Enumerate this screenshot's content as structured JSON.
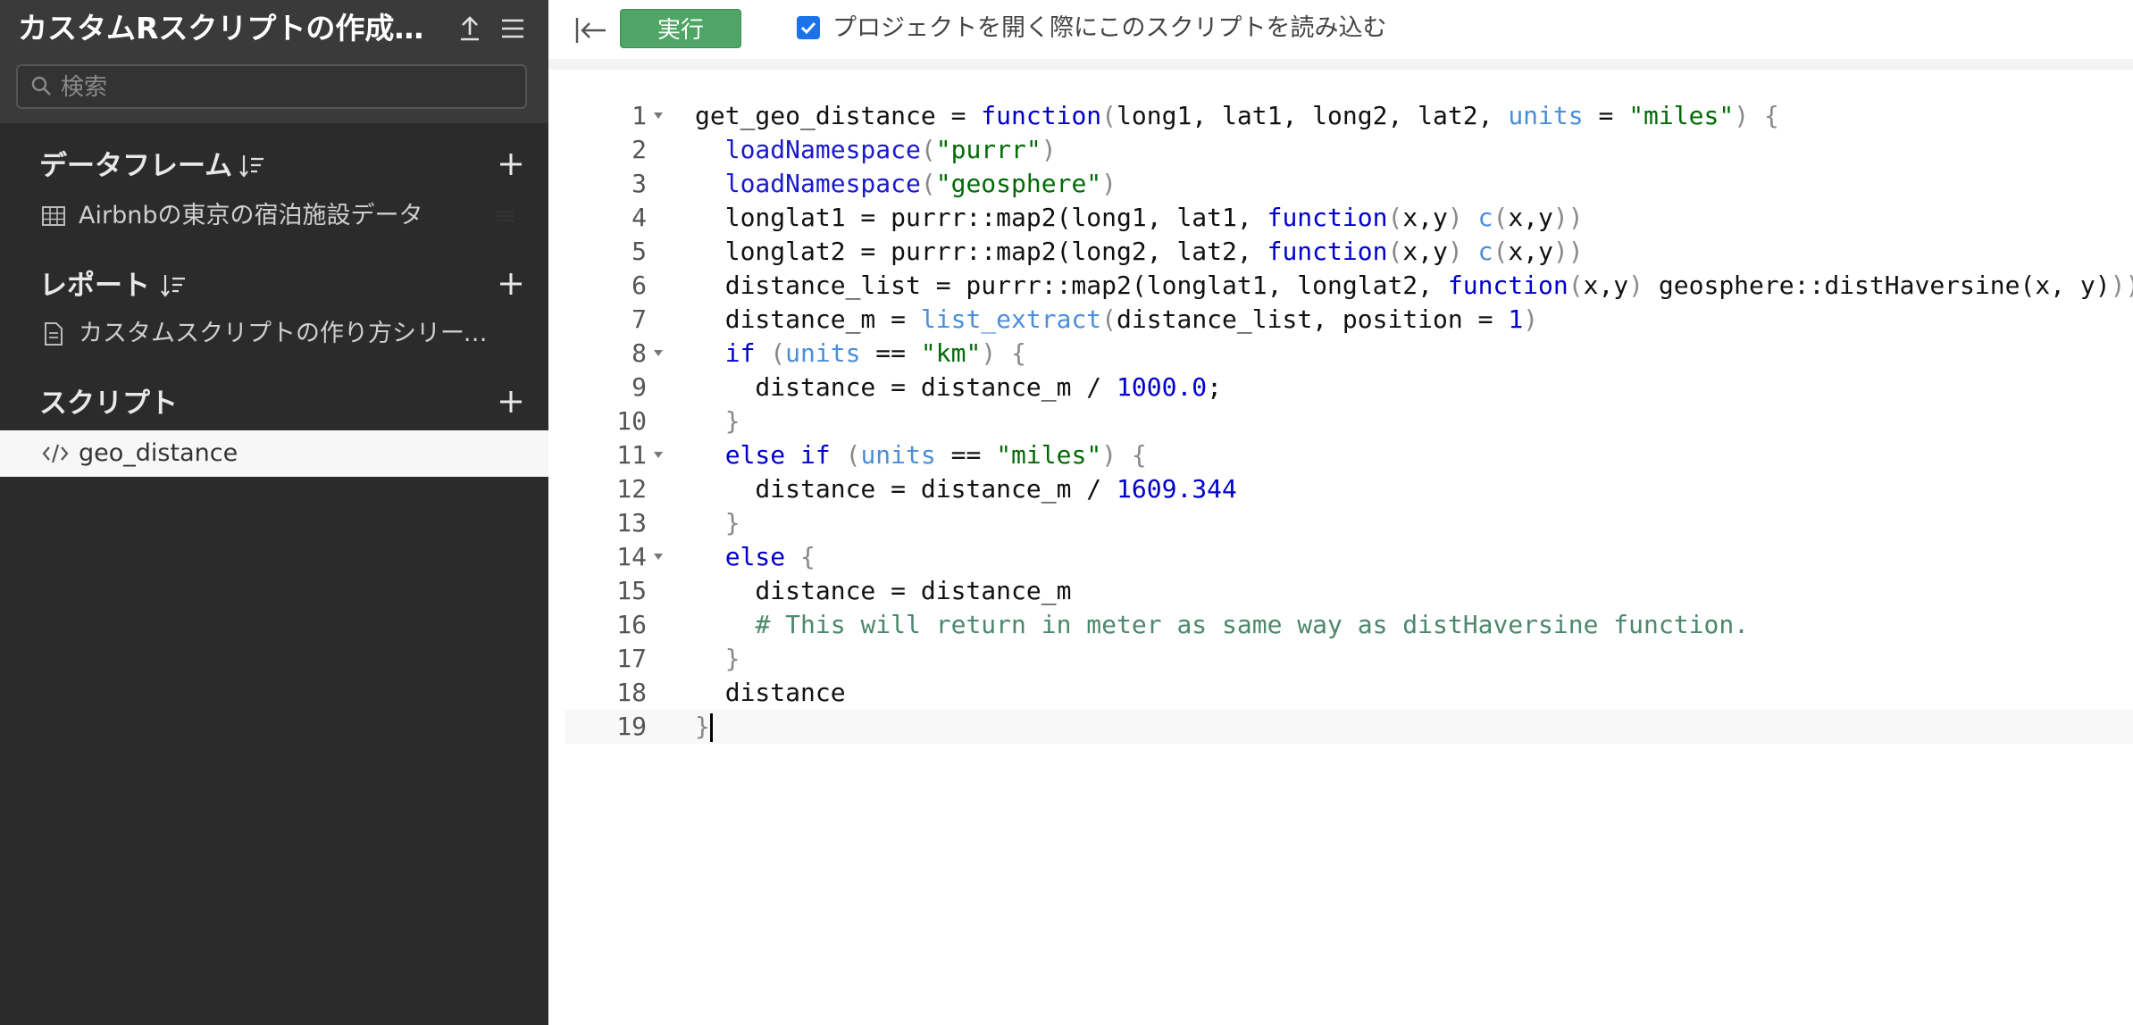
{
  "sidebar": {
    "project_title": "カスタムRスクリプトの作成シ...",
    "search_placeholder": "検索",
    "sections": {
      "dataframes": {
        "title": "データフレーム",
        "items": [
          {
            "label": "Airbnbの東京の宿泊施設データ"
          }
        ]
      },
      "reports": {
        "title": "レポート",
        "items": [
          {
            "label": "カスタムスクリプトの作り方シリーズ: ..."
          }
        ]
      },
      "scripts": {
        "title": "スクリプト",
        "items": [
          {
            "label": "geo_distance"
          }
        ]
      }
    },
    "icons": {
      "upload": "upload-icon",
      "menu": "hamburger-menu-icon",
      "search": "search-icon",
      "sort": "sort-icon",
      "add": "plus-icon",
      "table": "table-icon",
      "document": "document-icon",
      "code": "code-icon"
    }
  },
  "toolbar": {
    "run_label": "実行",
    "load_on_open_label": "プロジェクトを開く際にこのスクリプトを読み込む",
    "load_on_open_checked": true
  },
  "colors": {
    "sidebar_bg": "#2b2b2b",
    "sidebar_header_bg": "#3a3a3a",
    "run_button": "#4ea565",
    "checkbox": "#1a73e8"
  },
  "editor": {
    "current_line": 19,
    "lines": [
      {
        "n": "1",
        "fold": true,
        "tokens": [
          [
            "plain",
            "get_geo_distance = "
          ],
          [
            "kw",
            "function"
          ],
          [
            "paren",
            "("
          ],
          [
            "plain",
            "long1, lat1, long2, lat2, "
          ],
          [
            "param",
            "units"
          ],
          [
            "plain",
            " = "
          ],
          [
            "str",
            "\"miles\""
          ],
          [
            "paren",
            ")"
          ],
          [
            "plain",
            " "
          ],
          [
            "paren",
            "{"
          ]
        ]
      },
      {
        "n": "2",
        "fold": false,
        "tokens": [
          [
            "plain",
            "  "
          ],
          [
            "fn",
            "loadNamespace"
          ],
          [
            "paren",
            "("
          ],
          [
            "str",
            "\"purrr\""
          ],
          [
            "paren",
            ")"
          ]
        ]
      },
      {
        "n": "3",
        "fold": false,
        "tokens": [
          [
            "plain",
            "  "
          ],
          [
            "fn",
            "loadNamespace"
          ],
          [
            "paren",
            "("
          ],
          [
            "str",
            "\"geosphere\""
          ],
          [
            "paren",
            ")"
          ]
        ]
      },
      {
        "n": "4",
        "fold": false,
        "tokens": [
          [
            "plain",
            "  longlat1 = purrr::map2(long1, lat1, "
          ],
          [
            "kw",
            "function"
          ],
          [
            "paren",
            "("
          ],
          [
            "plain",
            "x,y"
          ],
          [
            "paren",
            ")"
          ],
          [
            "plain",
            " "
          ],
          [
            "call",
            "c"
          ],
          [
            "paren",
            "("
          ],
          [
            "plain",
            "x,y"
          ],
          [
            "paren",
            "))"
          ]
        ]
      },
      {
        "n": "5",
        "fold": false,
        "tokens": [
          [
            "plain",
            "  longlat2 = purrr::map2(long2, lat2, "
          ],
          [
            "kw",
            "function"
          ],
          [
            "paren",
            "("
          ],
          [
            "plain",
            "x,y"
          ],
          [
            "paren",
            ")"
          ],
          [
            "plain",
            " "
          ],
          [
            "call",
            "c"
          ],
          [
            "paren",
            "("
          ],
          [
            "plain",
            "x,y"
          ],
          [
            "paren",
            "))"
          ]
        ]
      },
      {
        "n": "6",
        "fold": false,
        "tokens": [
          [
            "plain",
            "  distance_list = purrr::map2(longlat1, longlat2, "
          ],
          [
            "kw",
            "function"
          ],
          [
            "paren",
            "("
          ],
          [
            "plain",
            "x,y"
          ],
          [
            "paren",
            ")"
          ],
          [
            "plain",
            " geosphere::distHaversine(x, y)"
          ],
          [
            "paren",
            "))"
          ]
        ]
      },
      {
        "n": "7",
        "fold": false,
        "tokens": [
          [
            "plain",
            "  distance_m = "
          ],
          [
            "call",
            "list_extract"
          ],
          [
            "paren",
            "("
          ],
          [
            "plain",
            "distance_list, position = "
          ],
          [
            "num",
            "1"
          ],
          [
            "paren",
            ")"
          ]
        ]
      },
      {
        "n": "8",
        "fold": true,
        "tokens": [
          [
            "plain",
            "  "
          ],
          [
            "kw",
            "if"
          ],
          [
            "plain",
            " "
          ],
          [
            "paren",
            "("
          ],
          [
            "param",
            "units"
          ],
          [
            "plain",
            " == "
          ],
          [
            "str",
            "\"km\""
          ],
          [
            "paren",
            ")"
          ],
          [
            "plain",
            " "
          ],
          [
            "paren",
            "{"
          ]
        ]
      },
      {
        "n": "9",
        "fold": false,
        "tokens": [
          [
            "plain",
            "    distance = distance_m / "
          ],
          [
            "num",
            "1000.0"
          ],
          [
            "plain",
            ";"
          ]
        ]
      },
      {
        "n": "10",
        "fold": false,
        "tokens": [
          [
            "plain",
            "  "
          ],
          [
            "paren",
            "}"
          ]
        ]
      },
      {
        "n": "11",
        "fold": true,
        "tokens": [
          [
            "plain",
            "  "
          ],
          [
            "kw",
            "else if"
          ],
          [
            "plain",
            " "
          ],
          [
            "paren",
            "("
          ],
          [
            "param",
            "units"
          ],
          [
            "plain",
            " == "
          ],
          [
            "str",
            "\"miles\""
          ],
          [
            "paren",
            ")"
          ],
          [
            "plain",
            " "
          ],
          [
            "paren",
            "{"
          ]
        ]
      },
      {
        "n": "12",
        "fold": false,
        "tokens": [
          [
            "plain",
            "    distance = distance_m / "
          ],
          [
            "num",
            "1609.344"
          ]
        ]
      },
      {
        "n": "13",
        "fold": false,
        "tokens": [
          [
            "plain",
            "  "
          ],
          [
            "paren",
            "}"
          ]
        ]
      },
      {
        "n": "14",
        "fold": true,
        "tokens": [
          [
            "plain",
            "  "
          ],
          [
            "kw",
            "else"
          ],
          [
            "plain",
            " "
          ],
          [
            "paren",
            "{"
          ]
        ]
      },
      {
        "n": "15",
        "fold": false,
        "tokens": [
          [
            "plain",
            "    distance = distance_m"
          ]
        ]
      },
      {
        "n": "16",
        "fold": false,
        "tokens": [
          [
            "plain",
            "    "
          ],
          [
            "cmt",
            "# This will return in meter as same way as distHaversine function."
          ]
        ]
      },
      {
        "n": "17",
        "fold": false,
        "tokens": [
          [
            "plain",
            "  "
          ],
          [
            "paren",
            "}"
          ]
        ]
      },
      {
        "n": "18",
        "fold": false,
        "tokens": [
          [
            "plain",
            "  distance"
          ]
        ]
      },
      {
        "n": "19",
        "fold": false,
        "tokens": [
          [
            "paren",
            "}"
          ]
        ]
      }
    ]
  }
}
